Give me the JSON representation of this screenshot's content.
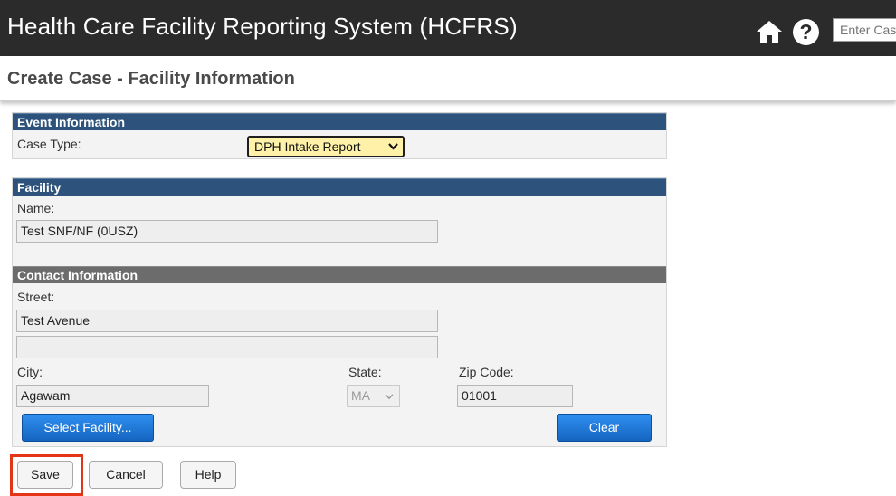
{
  "header": {
    "app_title": "Health Care Facility Reporting System (HCFRS)",
    "search_placeholder": "Enter Case",
    "colors": {
      "topbar": "#2b2b2b",
      "section_header": "#2d527b",
      "highlight": "#e53517"
    }
  },
  "page": {
    "title": "Create Case - Facility Information"
  },
  "event": {
    "section_title": "Event Information",
    "case_type_label": "Case Type:",
    "case_type_value": "DPH Intake Report"
  },
  "facility": {
    "section_title": "Facility",
    "name_label": "Name:",
    "name_value": "Test SNF/NF (0USZ)"
  },
  "contact": {
    "section_title": "Contact Information",
    "street_label": "Street:",
    "street_value": "Test Avenue",
    "street2_value": "",
    "city_label": "City:",
    "city_value": "Agawam",
    "state_label": "State:",
    "state_value": "MA",
    "zip_label": "Zip Code:",
    "zip_value": "01001",
    "select_facility_label": "Select Facility...",
    "clear_label": "Clear"
  },
  "actions": {
    "save": "Save",
    "cancel": "Cancel",
    "help": "Help"
  },
  "icons": [
    "home-icon",
    "help-circle-icon",
    "chevron-down-icon"
  ]
}
